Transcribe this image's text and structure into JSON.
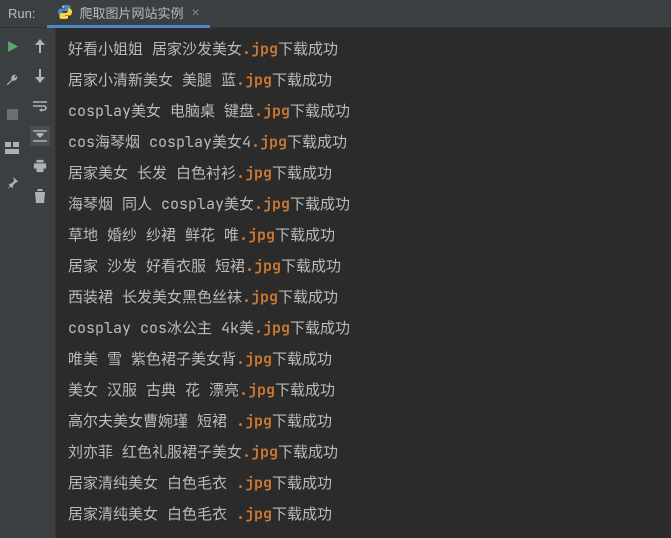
{
  "header": {
    "run_label": "Run:",
    "tab_title": "爬取图片网站实例",
    "tab_close": "×"
  },
  "console_lines": [
    {
      "pre": "好看小姐姐 居家沙发美女",
      "ext": ".jpg",
      "post": "下载成功"
    },
    {
      "pre": "居家小清新美女 美腿 蓝",
      "ext": ".jpg",
      "post": "下载成功"
    },
    {
      "pre": "cosplay美女 电脑桌 键盘",
      "ext": ".jpg",
      "post": "下载成功"
    },
    {
      "pre": "cos海琴烟 cosplay美女4",
      "ext": ".jpg",
      "post": "下载成功"
    },
    {
      "pre": "居家美女 长发 白色衬衫",
      "ext": ".jpg",
      "post": "下载成功"
    },
    {
      "pre": "海琴烟 同人 cosplay美女",
      "ext": ".jpg",
      "post": "下载成功"
    },
    {
      "pre": "草地 婚纱 纱裙 鲜花 唯",
      "ext": ".jpg",
      "post": "下载成功"
    },
    {
      "pre": "居家 沙发 好看衣服 短裙",
      "ext": ".jpg",
      "post": "下载成功"
    },
    {
      "pre": "西装裙 长发美女黑色丝袜",
      "ext": ".jpg",
      "post": "下载成功"
    },
    {
      "pre": "cosplay cos冰公主 4k美",
      "ext": ".jpg",
      "post": "下载成功"
    },
    {
      "pre": "唯美 雪 紫色裙子美女背",
      "ext": ".jpg",
      "post": "下载成功"
    },
    {
      "pre": "美女 汉服 古典 花 漂亮",
      "ext": ".jpg",
      "post": "下载成功"
    },
    {
      "pre": "高尔夫美女曹婉瑾 短裙 ",
      "ext": ".jpg",
      "post": "下载成功"
    },
    {
      "pre": "刘亦菲 红色礼服裙子美女",
      "ext": ".jpg",
      "post": "下载成功"
    },
    {
      "pre": "居家清纯美女 白色毛衣 ",
      "ext": ".jpg",
      "post": "下载成功"
    },
    {
      "pre": "居家清纯美女 白色毛衣 ",
      "ext": ".jpg",
      "post": "下载成功"
    }
  ]
}
